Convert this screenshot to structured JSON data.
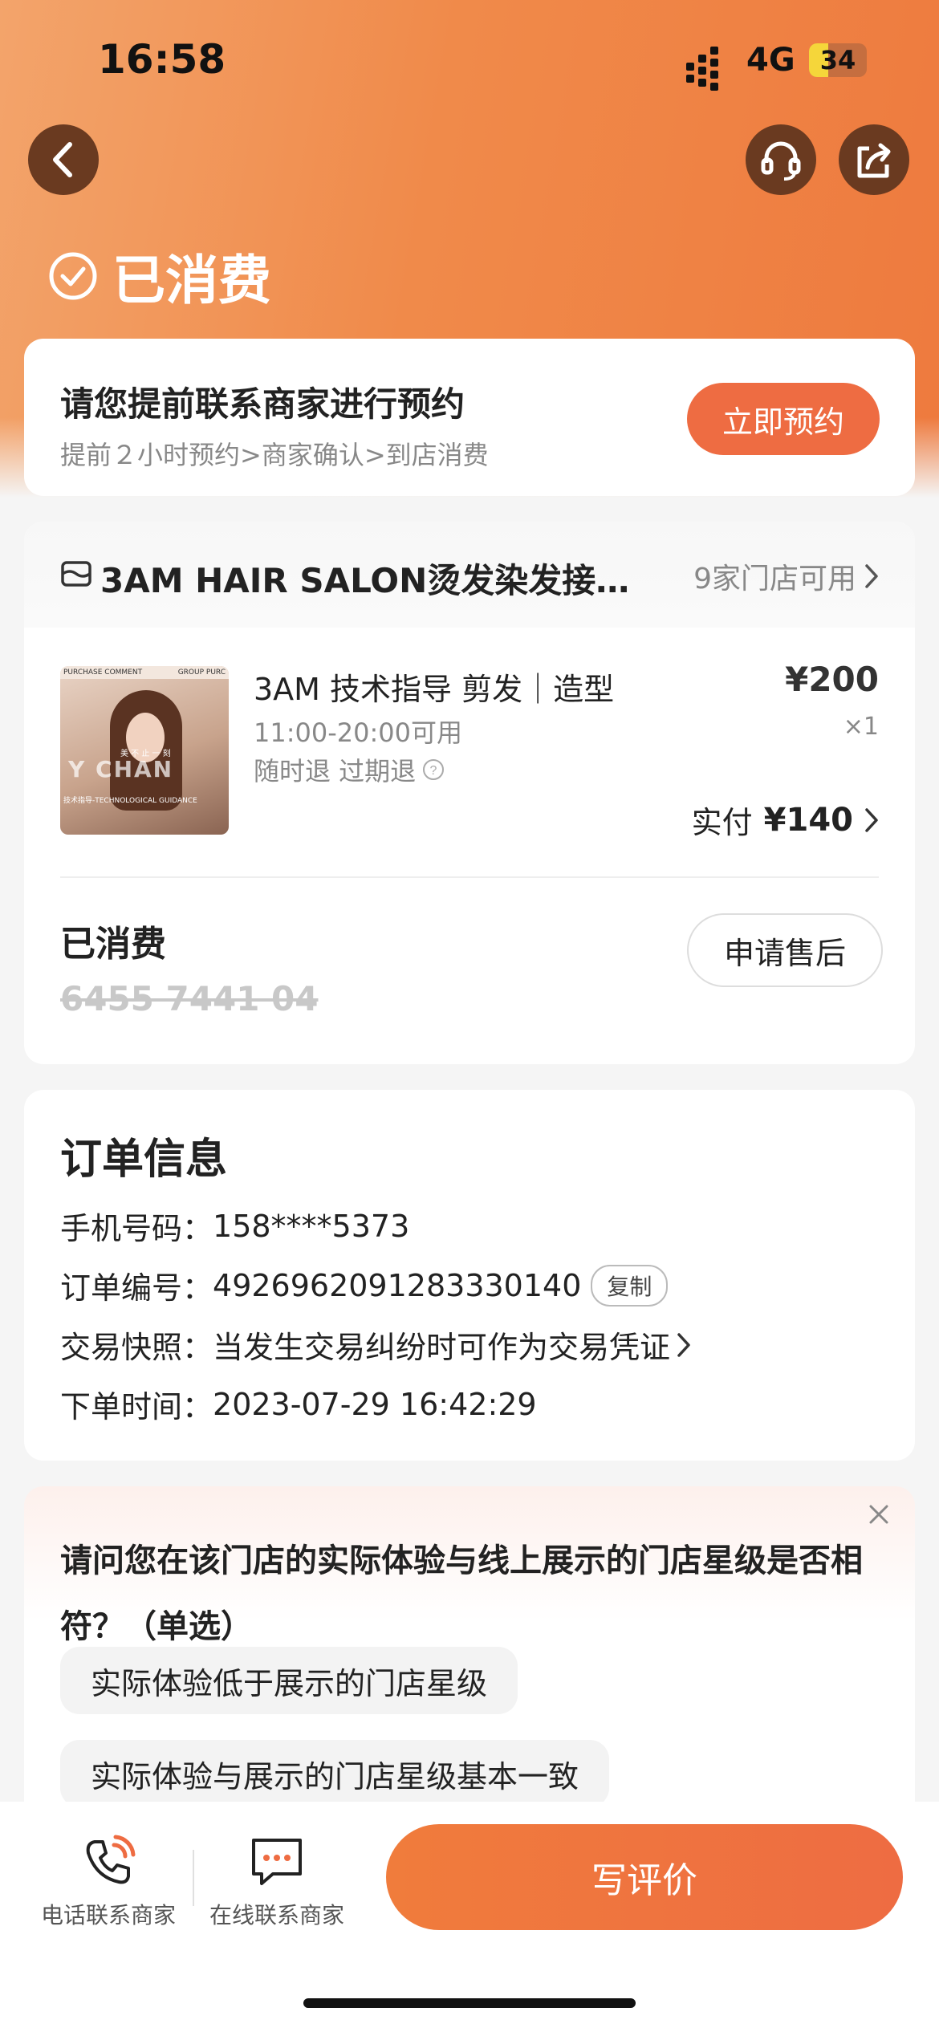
{
  "status_bar": {
    "time": "16:58",
    "network": "4G",
    "battery": "34"
  },
  "header": {
    "status_label": "已消费",
    "back_icon": "back-icon",
    "service_icon": "headset-icon",
    "share_icon": "share-icon"
  },
  "booking": {
    "title": "请您提前联系商家进行预约",
    "subtitle": "提前２小时预约>商家确认>到店消费",
    "button": "立即预约"
  },
  "shop": {
    "name": "3AM HAIR SALON烫发染发接…",
    "stores": "9家门店可用",
    "product": {
      "title": "3AM 技术指导 剪发｜造型",
      "hours": "11:00-20:00可用",
      "refund": "随时退 过期退",
      "price": "¥200",
      "qty": "×1",
      "paid_label": "实付",
      "paid_value": "¥140",
      "thumb_text_top_left": "PURCHASE COMMENT",
      "thumb_text_top_right": "GROUP PURC",
      "thumb_text_mid": "美 不 止 一 刻",
      "thumb_text_big": "Y CHAN",
      "thumb_text_bottom": "技术指导-TECHNOLOGICAL GUIDANCE"
    },
    "consumed_label": "已消费",
    "coupon_code": "6455 7441 04",
    "after_sale": "申请售后"
  },
  "order_info": {
    "title": "订单信息",
    "phone_label": "手机号码：",
    "phone_value": "158****5373",
    "order_label": "订单编号：",
    "order_value": "4926962091283330140",
    "copy": "复制",
    "snapshot_label": "交易快照：",
    "snapshot_value": "当发生交易纠纷时可作为交易凭证",
    "time_label": "下单时间：",
    "time_value": "2023-07-29 16:42:29"
  },
  "survey": {
    "question": "请问您在该门店的实际体验与线上展示的门店星级是否相符？（单选）",
    "options": [
      "实际体验低于展示的门店星级",
      "实际体验与展示的门店星级基本一致"
    ]
  },
  "bottom": {
    "phone_contact": "电话联系商家",
    "online_contact": "在线联系商家",
    "review_button": "写评价"
  },
  "colors": {
    "accent": "#ee6c42",
    "header_start": "#f3a46b",
    "header_end": "#ee7a3e"
  }
}
